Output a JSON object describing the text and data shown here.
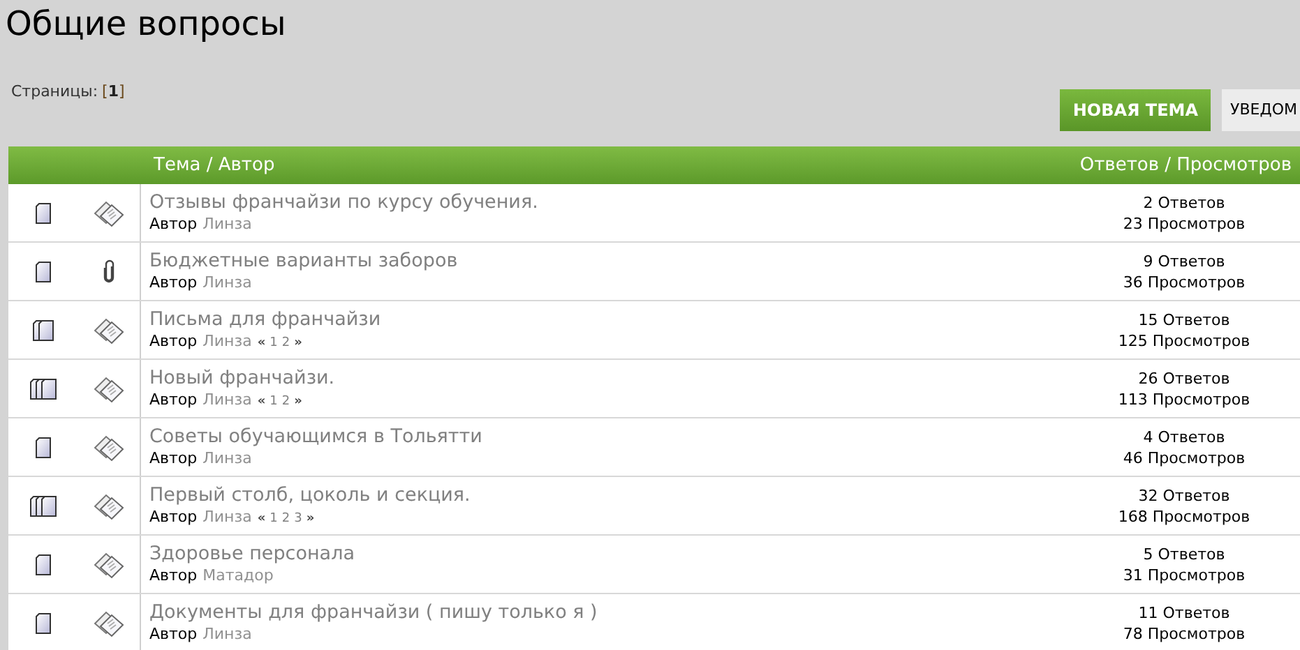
{
  "title": "Общие вопросы",
  "pagination": {
    "label": "Страницы:",
    "open": "[",
    "current": "1",
    "close": "]"
  },
  "buttons": [
    {
      "label": "НОВАЯ ТЕМА",
      "kind": "primary"
    },
    {
      "label": "УВЕДОМ",
      "kind": "secondary"
    }
  ],
  "table": {
    "columns": [
      "Тема / Автор",
      "Ответов / Просмотров"
    ],
    "rows": [
      {
        "kind": "normal",
        "attachment": false,
        "topic": "Отзывы франчайзи по курсу обучения.",
        "author_label": "Автор",
        "author": "Линза",
        "replies": "2 Ответов",
        "views": "23 Просмотров"
      },
      {
        "kind": "normal",
        "attachment": true,
        "topic": "Бюджетные варианты заборов",
        "author_label": "Автор",
        "author": "Линза",
        "replies": "9 Ответов",
        "views": "36 Просмотров"
      },
      {
        "kind": "popular",
        "attachment": false,
        "topic": "Письма для франчайзи",
        "author_label": "Автор",
        "author": "Линза",
        "pages": [
          "«",
          "1",
          "2",
          "»"
        ],
        "replies": "15 Ответов",
        "views": "125 Просмотров"
      },
      {
        "kind": "hot",
        "attachment": false,
        "topic": "Новый франчайзи.",
        "author_label": "Автор",
        "author": "Линза",
        "pages": [
          "«",
          "1",
          "2",
          "»"
        ],
        "replies": "26 Ответов",
        "views": "113 Просмотров"
      },
      {
        "kind": "normal",
        "attachment": false,
        "topic": "Советы обучающимся в Тольятти",
        "author_label": "Автор",
        "author": "Линза",
        "replies": "4 Ответов",
        "views": "46 Просмотров"
      },
      {
        "kind": "hot",
        "attachment": false,
        "topic": "Первый столб, цоколь и секция.",
        "author_label": "Автор",
        "author": "Линза",
        "pages": [
          "«",
          "1",
          "2",
          "3",
          "»"
        ],
        "replies": "32 Ответов",
        "views": "168 Просмотров"
      },
      {
        "kind": "normal",
        "attachment": false,
        "topic": "Здоровье персонала",
        "author_label": "Автор",
        "author": "Матадор",
        "replies": "5 Ответов",
        "views": "31 Просмотров"
      },
      {
        "kind": "normal",
        "attachment": false,
        "topic": "Документы для франчайзи ( пишу только я )",
        "author_label": "Автор",
        "author": "Линза",
        "replies": "11 Ответов",
        "views": "78 Просмотров"
      }
    ]
  }
}
